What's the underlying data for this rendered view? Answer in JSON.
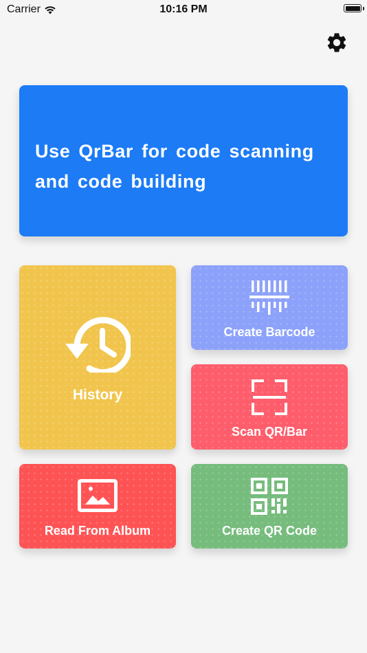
{
  "status_bar": {
    "carrier": "Carrier",
    "time": "10:16 PM"
  },
  "header": {
    "settings_icon": "gear-icon"
  },
  "banner": {
    "text": "Use QrBar for code scanning and code building",
    "color": "#1c7bf5"
  },
  "tiles": [
    {
      "label": "History",
      "icon": "history-icon",
      "color": "#f1c54d"
    },
    {
      "label": "Create Barcode",
      "icon": "barcode-icon",
      "color": "#8ca1fa"
    },
    {
      "label": "Scan QR/Bar",
      "icon": "scan-icon",
      "color": "#fe5d6c"
    },
    {
      "label": "Read From Album",
      "icon": "image-icon",
      "color": "#fe5354"
    },
    {
      "label": "Create QR Code",
      "icon": "qr-code-icon",
      "color": "#76bc7d"
    }
  ]
}
